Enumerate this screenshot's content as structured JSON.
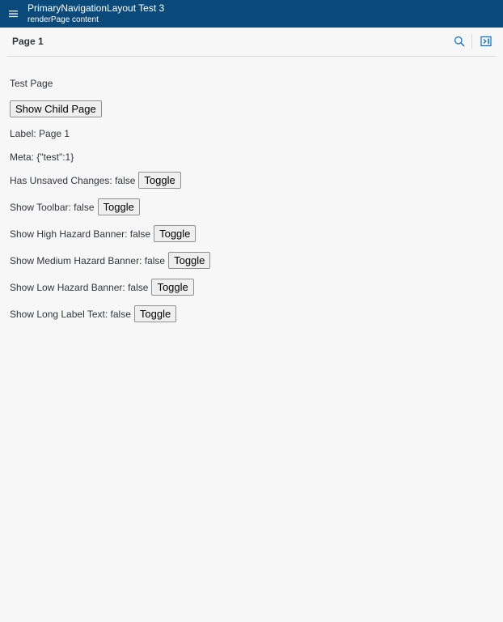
{
  "app": {
    "title": "PrimaryNavigationLayout Test 3",
    "subtitle": "renderPage content"
  },
  "icons": {
    "menu": "hamburger-menu-icon",
    "search": "search-icon",
    "collapse": "collapse-panel-icon"
  },
  "colors": {
    "topbar": "#0a4a7a",
    "background": "#f7f7f7",
    "icon_accent": "#0a6ed1"
  },
  "page": {
    "title": "Page 1"
  },
  "content": {
    "heading": "Test Page",
    "show_child_button": "Show Child Page",
    "label_line": "Label: Page 1",
    "meta_line": "Meta: {\"test\":1}",
    "toggles": [
      {
        "label": "Has Unsaved Changes: false",
        "button": "Toggle"
      },
      {
        "label": "Show Toolbar: false",
        "button": "Toggle"
      },
      {
        "label": "Show High Hazard Banner: false",
        "button": "Toggle"
      },
      {
        "label": "Show Medium Hazard Banner: false",
        "button": "Toggle"
      },
      {
        "label": "Show Low Hazard Banner: false",
        "button": "Toggle"
      },
      {
        "label": "Show Long Label Text: false",
        "button": "Toggle"
      }
    ]
  }
}
